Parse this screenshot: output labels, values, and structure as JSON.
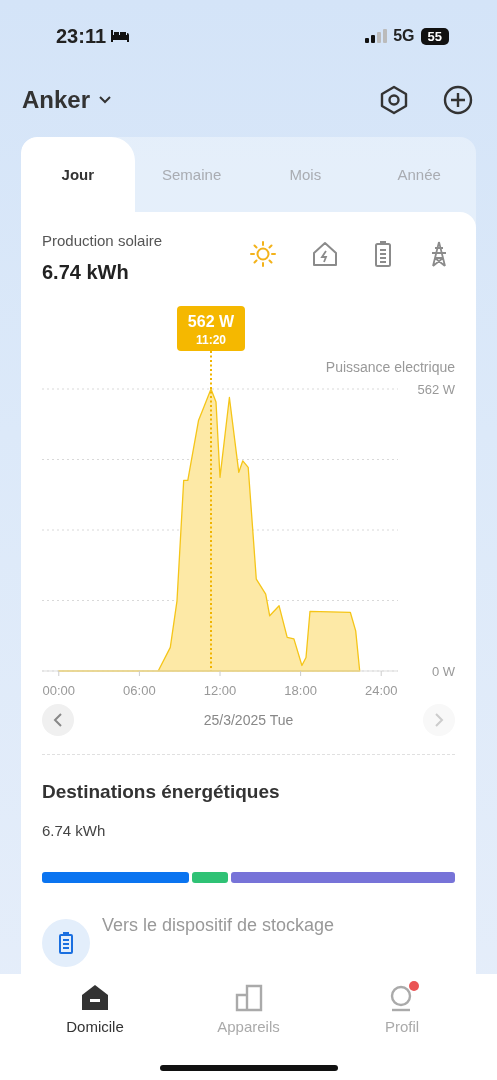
{
  "status_bar": {
    "time": "23:11",
    "network": "5G",
    "battery": "55"
  },
  "header": {
    "title": "Anker"
  },
  "tabs": [
    {
      "label": "Jour",
      "selected": true
    },
    {
      "label": "Semaine",
      "selected": false
    },
    {
      "label": "Mois",
      "selected": false
    },
    {
      "label": "Année",
      "selected": false
    }
  ],
  "summary": {
    "label": "Production solaire",
    "value": "6.74 kWh"
  },
  "source_icons": [
    {
      "kind": "solar",
      "selected": true
    },
    {
      "kind": "home",
      "selected": false
    },
    {
      "kind": "battery",
      "selected": false
    },
    {
      "kind": "grid",
      "selected": false
    }
  ],
  "chart": {
    "tooltip": {
      "value": "562 W",
      "time": "11:20"
    },
    "chart_data": {
      "type": "area",
      "ylabel": "Puissance electrique",
      "x": [
        0,
        7.4,
        8.3,
        8.8,
        9.3,
        9.6,
        10.4,
        10.8,
        11.33,
        11.7,
        12.0,
        12.7,
        13.4,
        13.7,
        14.1,
        14.7,
        15.4,
        15.7,
        16.4,
        17.0,
        17.5,
        18.1,
        18.4,
        18.7,
        21.7,
        22.1,
        22.4
      ],
      "series": [
        {
          "color": "#f5c518",
          "values": [
            0,
            0,
            47,
            140,
            380,
            380,
            499,
            526,
            562,
            536,
            386,
            545,
            396,
            419,
            406,
            183,
            153,
            110,
            130,
            67,
            64,
            11,
            27,
            119,
            117,
            80,
            0
          ]
        }
      ],
      "xlim": [
        -1.25,
        25.25
      ],
      "ylim": [
        0,
        562
      ],
      "xticks": [
        {
          "value": 0,
          "label": "00:00"
        },
        {
          "value": 6,
          "label": "06:00"
        },
        {
          "value": 12,
          "label": "12:00"
        },
        {
          "value": 18,
          "label": "18:00"
        },
        {
          "value": 24,
          "label": "24:00"
        }
      ],
      "yticks": [
        {
          "value": 0,
          "label": "0 W"
        },
        {
          "value": 562,
          "label": "562 W"
        }
      ],
      "ref_lines": [
        {
          "axis": "x",
          "value": 11.33,
          "color": "#f0b400"
        }
      ]
    }
  },
  "date_nav": {
    "date": "25/3/2025 Tue",
    "prev_disabled": false,
    "next_disabled": true
  },
  "destinations": {
    "title": "Destinations énergétiques",
    "value": "6.74 kWh",
    "segments": [
      {
        "color": "#0a74f0"
      },
      {
        "color": "#2fc275"
      },
      {
        "color": "#7773d8"
      }
    ],
    "items": [
      {
        "label": "Vers le dispositif de stockage"
      }
    ]
  },
  "bottom_nav": [
    {
      "label": "Domicile",
      "kind": "home",
      "selected": true,
      "badge": false
    },
    {
      "label": "Appareils",
      "kind": "devices",
      "selected": false,
      "badge": false
    },
    {
      "label": "Profil",
      "kind": "profile",
      "selected": false,
      "badge": true
    }
  ]
}
